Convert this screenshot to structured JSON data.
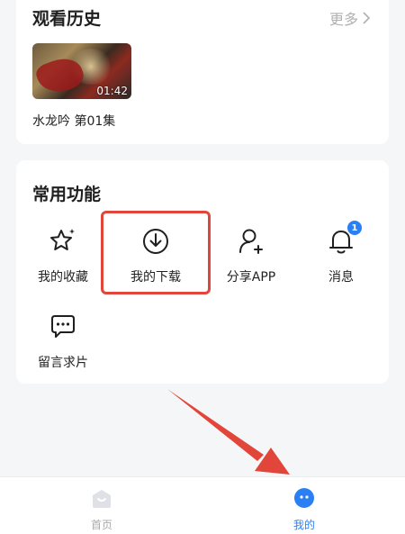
{
  "history": {
    "title": "观看历史",
    "more_label": "更多",
    "more_icon": "chevron-right-icon",
    "video": {
      "duration": "01:42",
      "title": "水龙吟 第01集"
    }
  },
  "functions": {
    "title": "常用功能",
    "items": [
      {
        "label": "我的收藏",
        "icon": "star-icon"
      },
      {
        "label": "我的下载",
        "icon": "download-icon"
      },
      {
        "label": "分享APP",
        "icon": "share-user-icon"
      },
      {
        "label": "消息",
        "icon": "bell-icon",
        "badge": "1"
      },
      {
        "label": "留言求片",
        "icon": "chat-bubble-icon"
      }
    ]
  },
  "tabbar": {
    "items": [
      {
        "label": "首页",
        "icon": "home-icon",
        "active": false
      },
      {
        "label": "我的",
        "icon": "profile-icon",
        "active": true
      }
    ]
  },
  "colors": {
    "accent": "#2b7ff5",
    "highlight": "#e2463a",
    "background": "#f5f6f8"
  }
}
